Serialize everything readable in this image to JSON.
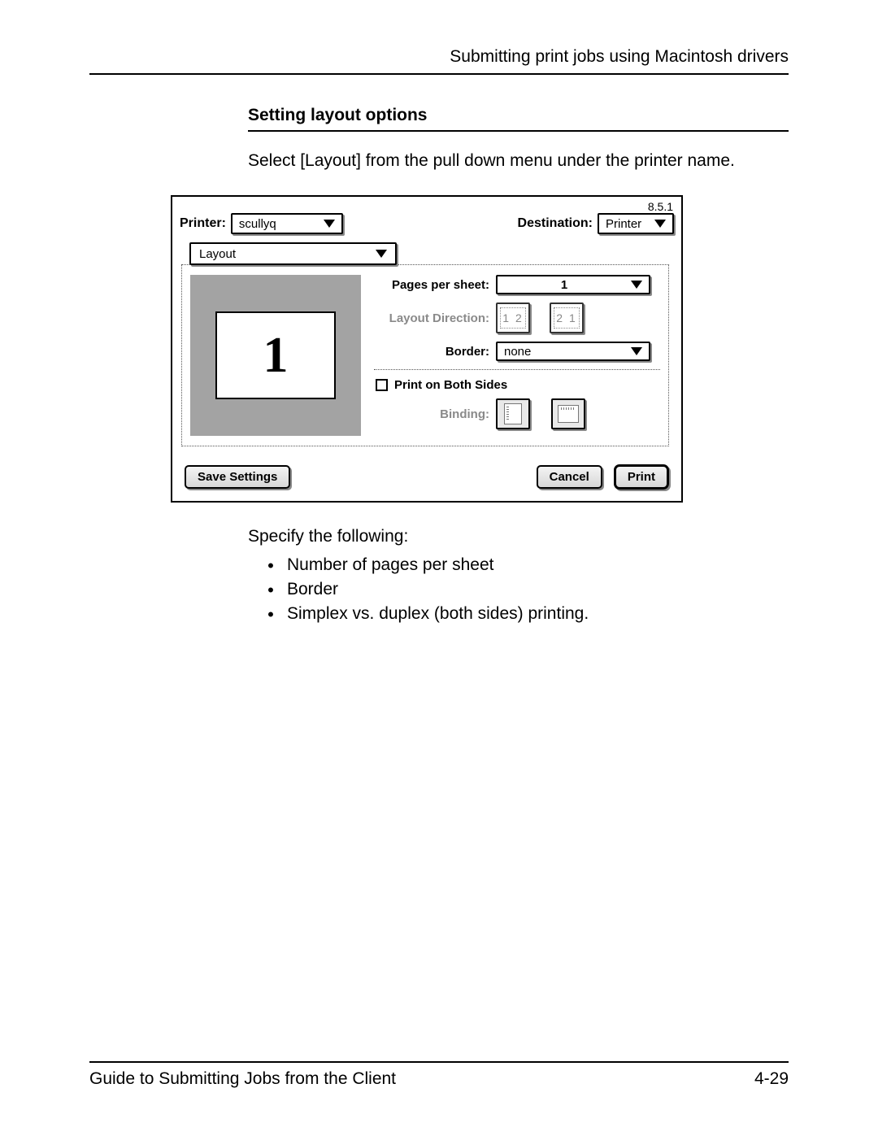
{
  "header": {
    "running_head": "Submitting print jobs using Macintosh drivers"
  },
  "section": {
    "title": "Setting layout options",
    "intro": "Select [Layout] from the pull down menu under the printer name."
  },
  "dialog": {
    "version": "8.5.1",
    "printer_label": "Printer:",
    "printer_value": "scullyq",
    "destination_label": "Destination:",
    "destination_value": "Printer",
    "tab_value": "Layout",
    "preview_number": "1",
    "pages_per_sheet_label": "Pages per sheet:",
    "pages_per_sheet_value": "1",
    "layout_direction_label": "Layout Direction:",
    "layout_direction_opts": {
      "lr": "1 2",
      "rl": "2 1"
    },
    "border_label": "Border:",
    "border_value": "none",
    "print_both_sides_label": "Print on Both Sides",
    "binding_label": "Binding:",
    "buttons": {
      "save": "Save Settings",
      "cancel": "Cancel",
      "print": "Print"
    }
  },
  "post": {
    "lead": "Specify the following:",
    "items": [
      "Number of pages per sheet",
      "Border",
      "Simplex vs. duplex (both sides) printing."
    ]
  },
  "footer": {
    "title": "Guide to Submitting Jobs from the Client",
    "pagenum": "4-29"
  }
}
